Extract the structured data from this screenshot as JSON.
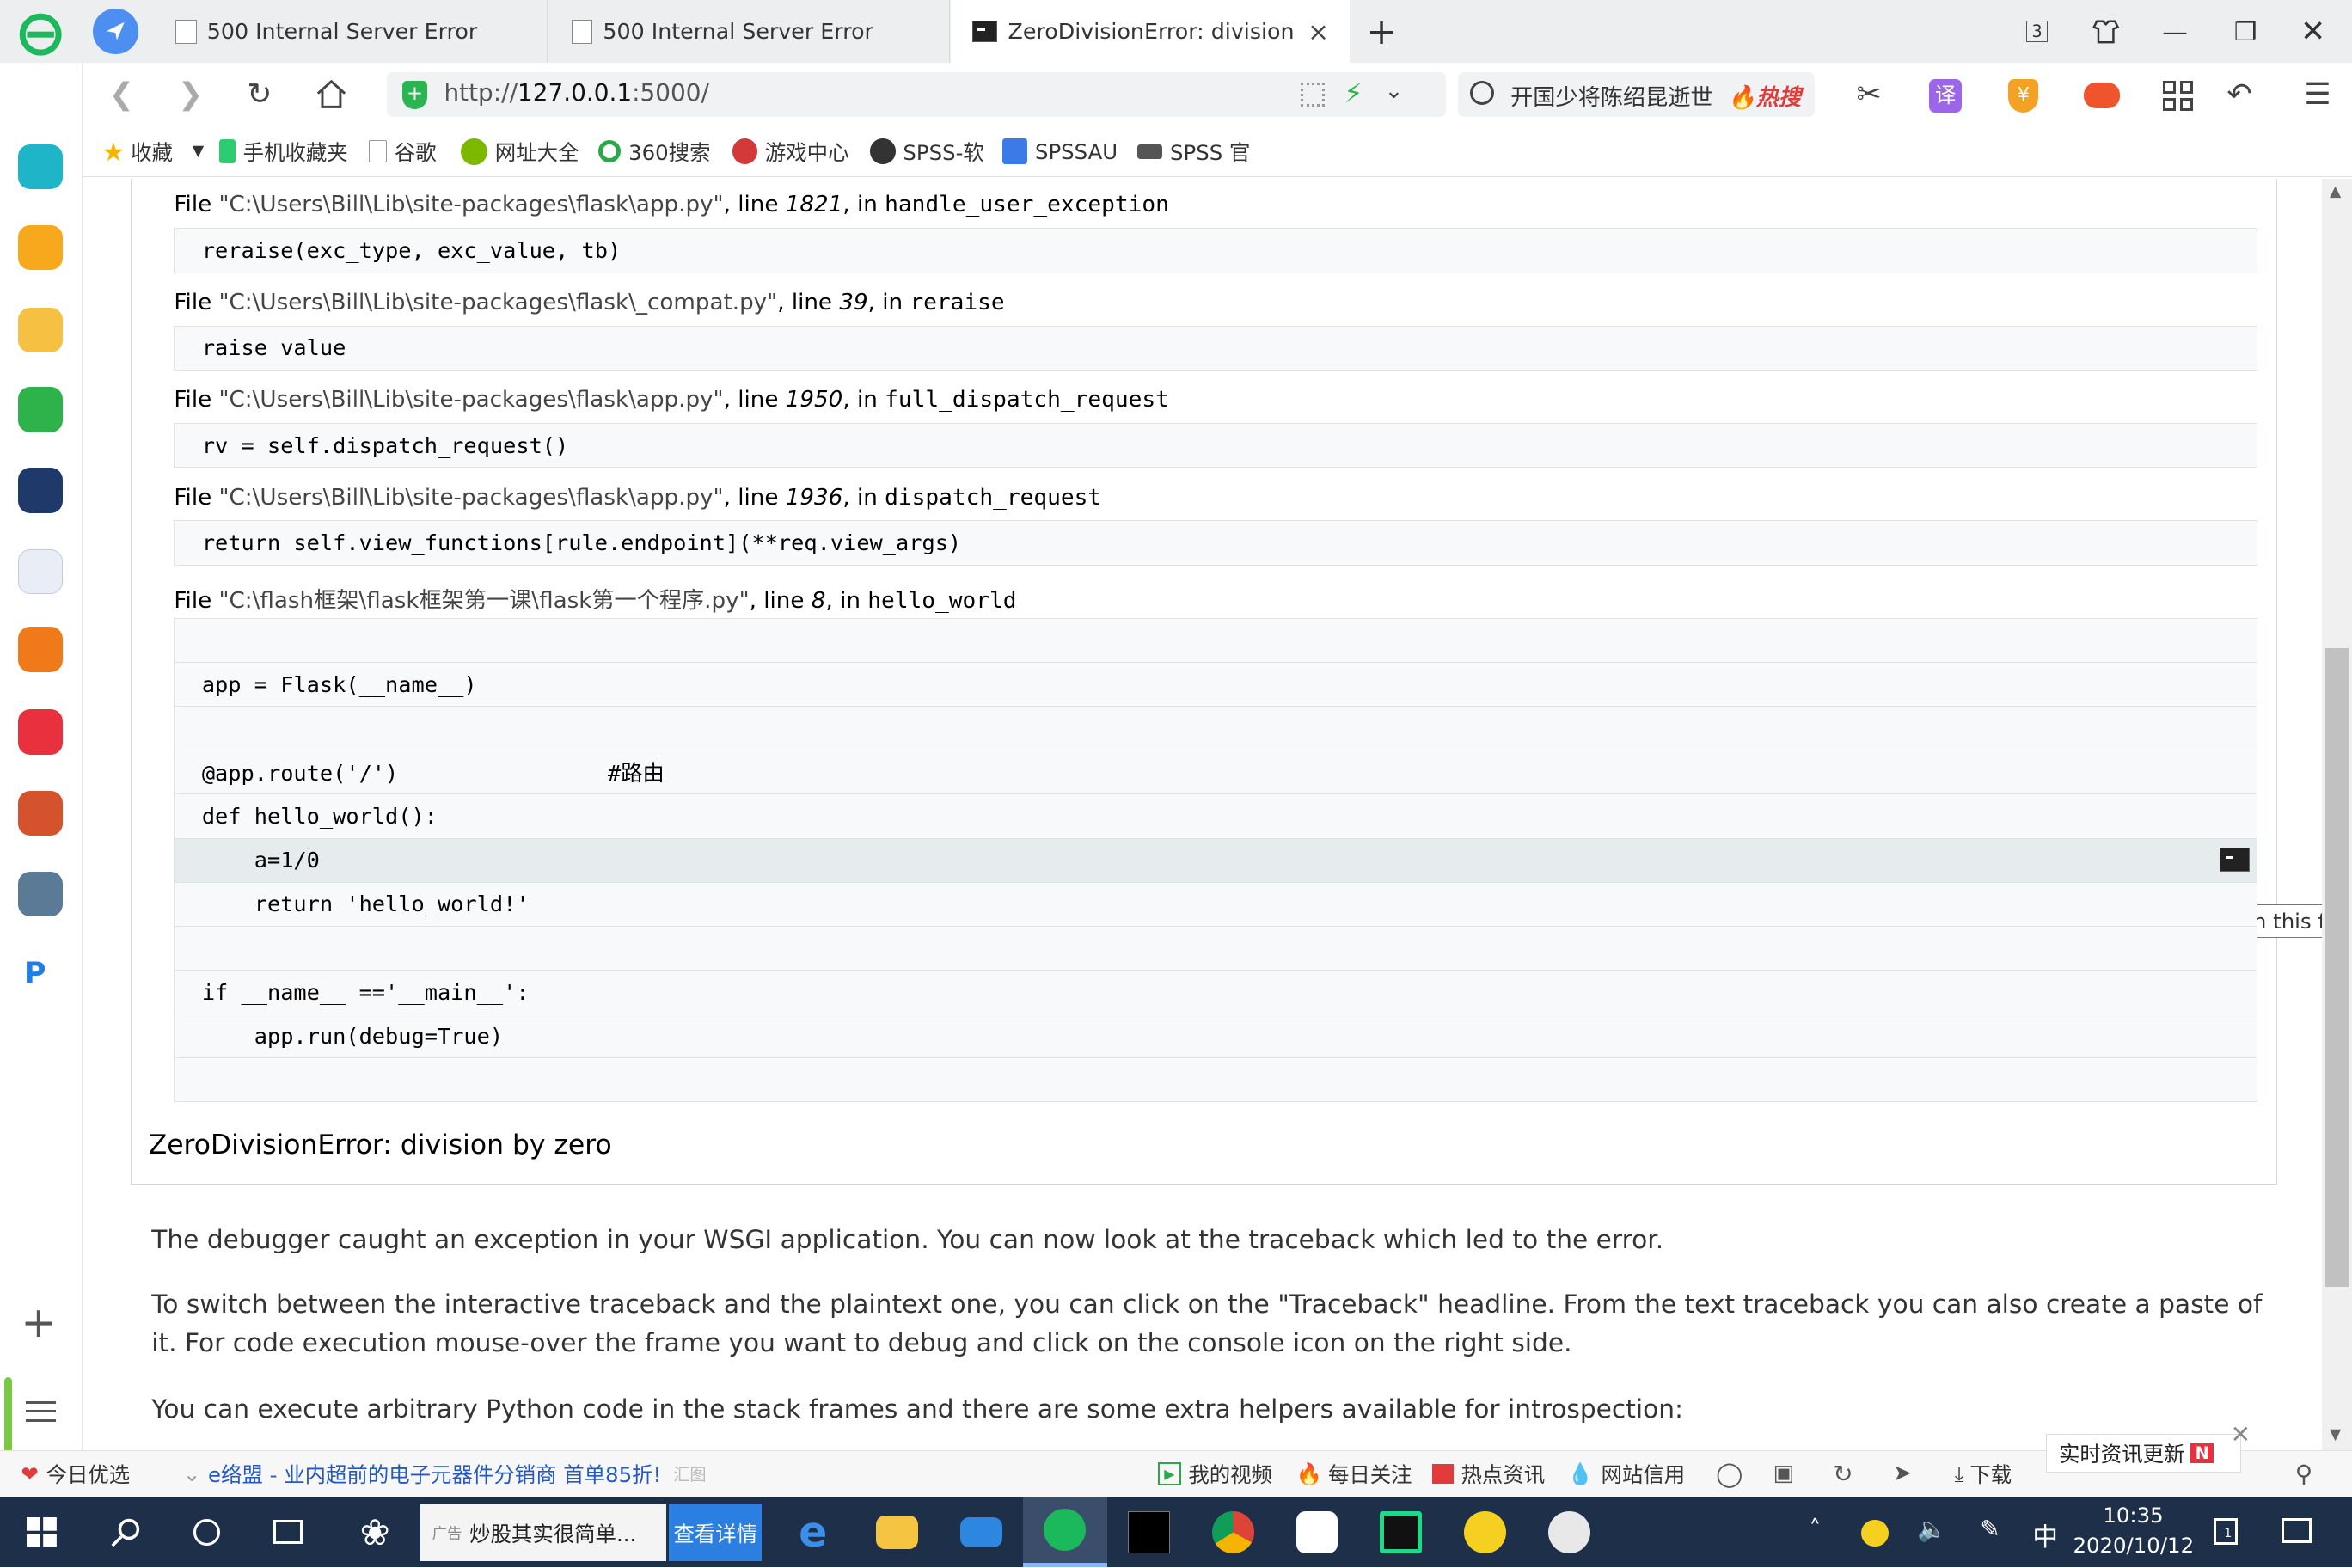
{
  "tabs": [
    {
      "title": "500 Internal Server Error"
    },
    {
      "title": "500 Internal Server Error"
    },
    {
      "title": "ZeroDivisionError: division by"
    }
  ],
  "window": {
    "tab_count": "3"
  },
  "address": {
    "url_prefix": "http://",
    "url_host": "127.0.0.1",
    "url_rest": ":5000/"
  },
  "search": {
    "text": "开国少将陈绍昆逝世",
    "hot_label": "热搜"
  },
  "bookmarks": [
    {
      "label": "收藏",
      "color": "#f4b400"
    },
    {
      "label": "手机收藏夹",
      "color": "#2ecc71"
    },
    {
      "label": "谷歌",
      "color": "#999999"
    },
    {
      "label": "网址大全",
      "color": "#7cb800"
    },
    {
      "label": "360搜索",
      "color": "#2aa84a"
    },
    {
      "label": "游戏中心",
      "color": "#d23a3a"
    },
    {
      "label": "SPSS-软",
      "color": "#333333"
    },
    {
      "label": "SPSSAU",
      "color": "#3b7be8"
    },
    {
      "label": "SPSS 官",
      "color": "#555555"
    }
  ],
  "frames": [
    {
      "file": "\"C:\\Users\\Bill\\Lib\\site-packages\\flask\\app.py\"",
      "line": "1821",
      "func": "handle_user_exception",
      "code": "reraise(exc_type, exc_value, tb)"
    },
    {
      "file": "\"C:\\Users\\Bill\\Lib\\site-packages\\flask\\_compat.py\"",
      "line": "39",
      "func": "reraise",
      "code": "raise value"
    },
    {
      "file": "\"C:\\Users\\Bill\\Lib\\site-packages\\flask\\app.py\"",
      "line": "1950",
      "func": "full_dispatch_request",
      "code": "rv = self.dispatch_request()"
    },
    {
      "file": "\"C:\\Users\\Bill\\Lib\\site-packages\\flask\\app.py\"",
      "line": "1936",
      "func": "dispatch_request",
      "code": "return self.view_functions[rule.endpoint](**req.view_args)"
    },
    {
      "file": "\"C:\\flash框架\\flask框架第一课\\flask第一个程序.py\"",
      "line": "8",
      "func": "hello_world",
      "code": ""
    }
  ],
  "frame_labels": {
    "file": "File ",
    "line": ", line ",
    "in": ", in "
  },
  "source_lines": [
    "",
    "app = Flask(__name__)",
    "",
    "@app.route('/')                #路由",
    "def hello_world():",
    "    a=1/0",
    "    return 'hello_world!'",
    "",
    "if __name__ =='__main__':",
    "    app.run(debug=True)",
    ""
  ],
  "error": {
    "title": "ZeroDivisionError: division by zero"
  },
  "tooltip": "Open an interactive python shell in this frame",
  "paragraphs": [
    "The debugger caught an exception in your WSGI application. You can now look at the traceback which led to the error.",
    "To switch between the interactive traceback and the plaintext one, you can click on the \"Traceback\" headline. From the text traceback you can also create a paste of it. For code execution mouse-over the frame you want to debug and click on the console icon on the right side.",
    "You can execute arbitrary Python code in the stack frames and there are some extra helpers available for introspection:"
  ],
  "statusbar": {
    "today": "今日优选",
    "ad": "e络盟 - 业内超前的电子元器件分销商 首单85折!",
    "ad_tag": "汇图",
    "items": [
      "我的视频",
      "每日关注",
      "热点资讯",
      "网站信用",
      "下载"
    ],
    "news": "实时资讯更新"
  },
  "taskbar": {
    "ad_tag": "广告",
    "ad_text": "炒股其实很简单...",
    "ad_btn": "查看详情",
    "time": "10:35",
    "date": "2020/10/12",
    "ime": "中",
    "notif": "1"
  },
  "colors": {
    "accent": "#1a73e8",
    "taskbar": "#1e2f4a",
    "frame_bg": "#f8f9fa",
    "current_line": "#e6ebee"
  }
}
